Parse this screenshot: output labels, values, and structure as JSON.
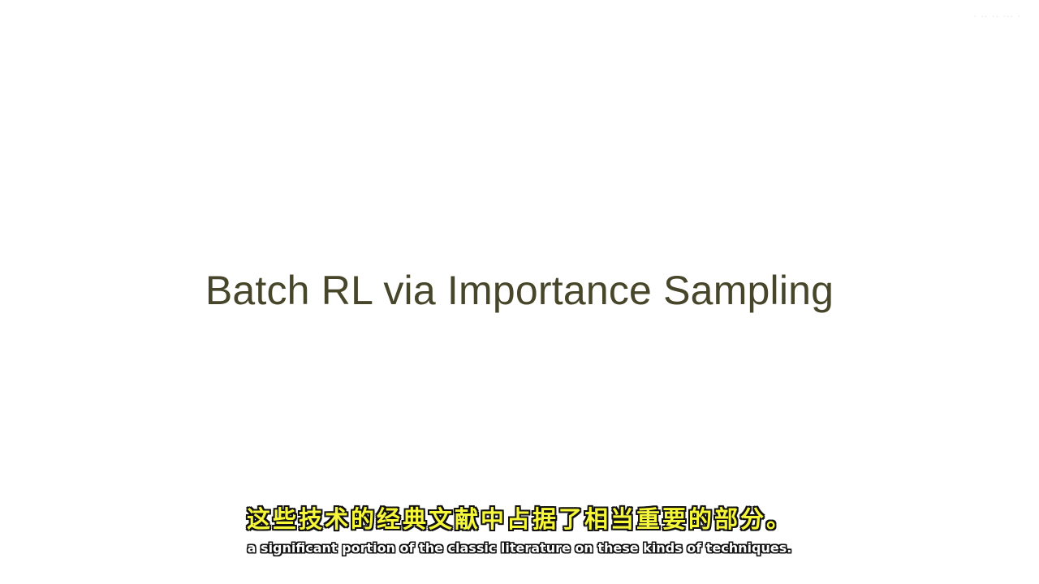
{
  "slide": {
    "title": "Batch RL via Importance Sampling",
    "watermark": "· ·· ·· ··· ·"
  },
  "subtitles": {
    "chinese": "这些技术的经典文献中占据了相当重要的部分。",
    "english": "a significant portion of the classic literature on these kinds of techniques."
  },
  "colors": {
    "background": "#ffffff",
    "title": "#47452a",
    "subtitle_zh": "#f7f73a",
    "subtitle_en": "#ffffff",
    "subtitle_outline": "#111111"
  }
}
